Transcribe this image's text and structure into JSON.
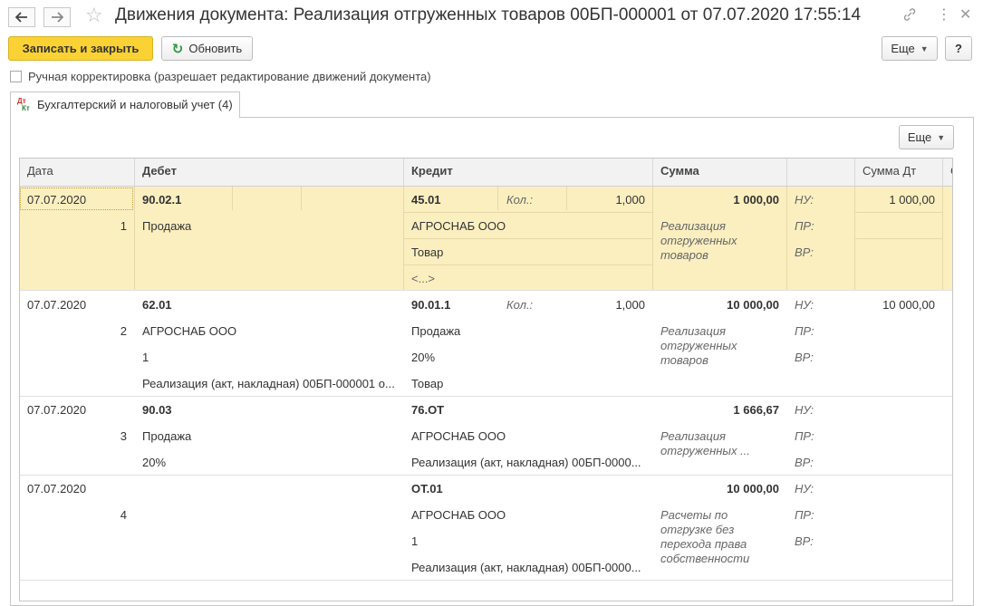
{
  "window": {
    "title": "Движения документа: Реализация отгруженных товаров 00БП-000001 от 07.07.2020 17:55:14",
    "icons": [
      "arrow-left-icon",
      "arrow-right-icon",
      "star-icon",
      "link-icon",
      "more-vertical-icon",
      "close-icon"
    ]
  },
  "toolbar": {
    "save_close_label": "Записать и закрыть",
    "refresh_label": "Обновить",
    "more_label": "Еще",
    "help_label": "?"
  },
  "manual_correction": {
    "label": "Ручная корректировка (разрешает редактирование движений документа)",
    "checked": false
  },
  "tab": {
    "label": "Бухгалтерский и налоговый учет (4)",
    "icon": "dt-kt-icon",
    "icon_dt": "Дт",
    "icon_kt": "Кт"
  },
  "table": {
    "more_label": "Еще",
    "headers": {
      "date": "Дата",
      "debit": "Дебет",
      "credit": "Кредит",
      "sum": "Сумма",
      "sum_dt": "Сумма Дт"
    },
    "rows": [
      {
        "date": "07.07.2020",
        "num": "1",
        "debit_account": "90.02.1",
        "debit_lines": [
          "Продажа",
          "",
          ""
        ],
        "credit_account": "45.01",
        "qty_label": "Кол.:",
        "qty": "1,000",
        "credit_lines": [
          "АГРОСНАБ ООО",
          "Товар",
          "<...>"
        ],
        "sum": "1 000,00",
        "content": "Реализация отгруженных товаров",
        "tags": [
          "НУ:",
          "ПР:",
          "ВР:"
        ],
        "sum_dt": "1 000,00"
      },
      {
        "date": "07.07.2020",
        "num": "2",
        "debit_account": "62.01",
        "debit_lines": [
          "АГРОСНАБ ООО",
          "1",
          "Реализация (акт, накладная) 00БП-000001 о..."
        ],
        "credit_account": "90.01.1",
        "qty_label": "Кол.:",
        "qty": "1,000",
        "credit_lines": [
          "Продажа",
          "20%",
          "Товар"
        ],
        "sum": "10 000,00",
        "content": "Реализация отгруженных товаров",
        "tags": [
          "НУ:",
          "ПР:",
          "ВР:"
        ],
        "sum_dt": "10 000,00"
      },
      {
        "date": "07.07.2020",
        "num": "3",
        "debit_account": "90.03",
        "debit_lines": [
          "Продажа",
          "20%"
        ],
        "credit_account": "76.ОТ",
        "credit_lines": [
          "АГРОСНАБ ООО",
          "Реализация (акт, накладная) 00БП-0000..."
        ],
        "sum": "1 666,67",
        "content": "Реализация отгруженных ...",
        "tags": [
          "НУ:",
          "ПР:",
          "ВР:"
        ]
      },
      {
        "date": "07.07.2020",
        "num": "4",
        "credit_account": "ОТ.01",
        "credit_lines": [
          "АГРОСНАБ ООО",
          "1",
          "Реализация (акт, накладная) 00БП-0000..."
        ],
        "sum": "10 000,00",
        "content": "Расчеты по отгрузке без перехода права собственности",
        "tags": [
          "НУ:",
          "ПР:",
          "ВР:"
        ]
      }
    ]
  }
}
